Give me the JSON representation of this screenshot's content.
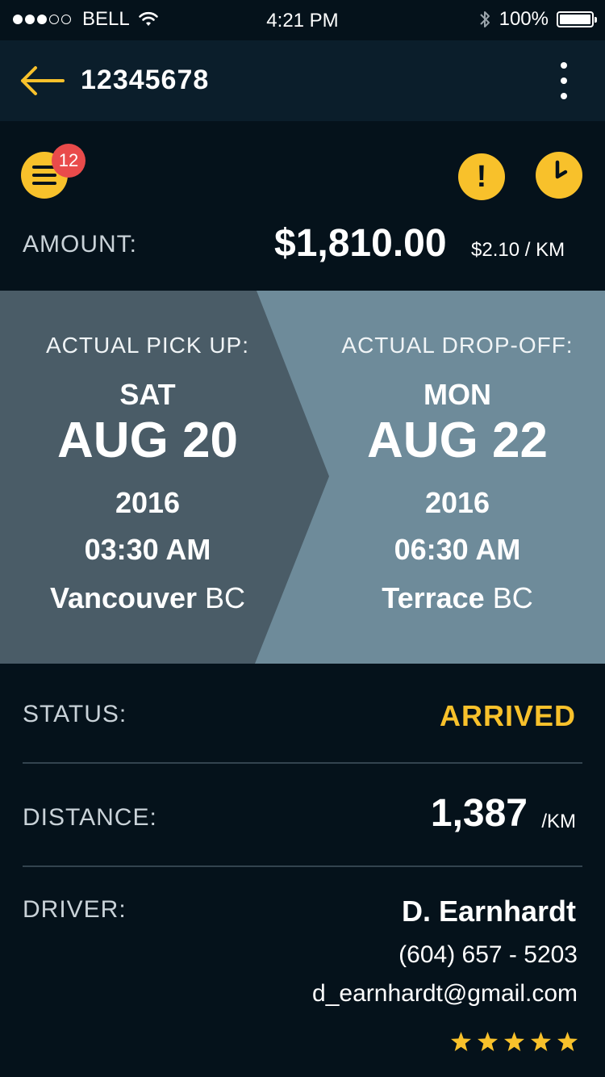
{
  "status_bar": {
    "carrier": "BELL",
    "time": "4:21 PM",
    "battery": "100%"
  },
  "nav": {
    "title": "12345678"
  },
  "summary": {
    "notification_count": "12",
    "amount_label": "AMOUNT:",
    "amount_value": "$1,810.00",
    "rate": "$2.10 / KM"
  },
  "pickup": {
    "label": "ACTUAL PICK UP:",
    "day": "SAT",
    "date": "AUG 20",
    "year": "2016",
    "time": "03:30 AM",
    "city": "Vancouver",
    "region": "BC"
  },
  "dropoff": {
    "label": "ACTUAL DROP-OFF:",
    "day": "MON",
    "date": "AUG 22",
    "year": "2016",
    "time": "06:30 AM",
    "city": "Terrace",
    "region": "BC"
  },
  "details": {
    "status_label": "STATUS:",
    "status_value": "ARRIVED",
    "distance_label": "DISTANCE:",
    "distance_value": "1,387",
    "distance_unit": "/KM",
    "driver_label": "DRIVER:",
    "driver_name": "D. Earnhardt",
    "driver_phone": "(604) 657 - 5203",
    "driver_email": "d_earnhardt@gmail.com",
    "driver_rating": 5
  },
  "colors": {
    "accent": "#f8c12b",
    "badge": "#e94b4b",
    "pickup_panel": "#4a5c67",
    "dropoff_panel": "#6e8b9a",
    "background": "#05121b"
  }
}
